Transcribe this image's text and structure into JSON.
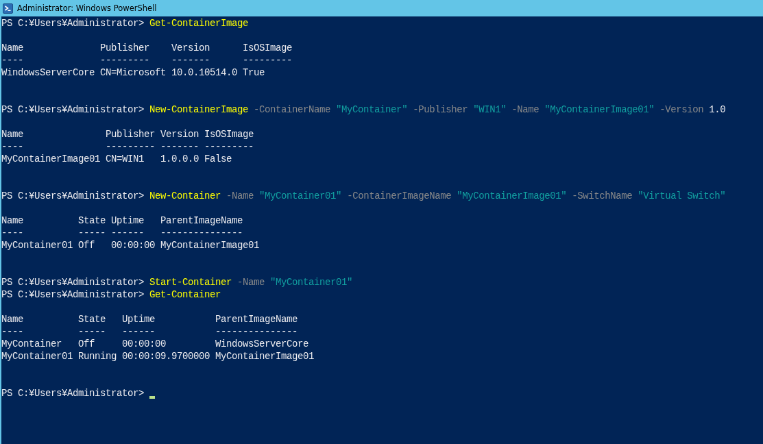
{
  "window": {
    "title": "Administrator: Windows PowerShell"
  },
  "console": {
    "entries": [
      {
        "kind": "command",
        "prompt": "PS C:¥Users¥Administrator>",
        "cursor": false,
        "tokens": [
          {
            "kind": "cmdlet",
            "text": "Get-ContainerImage"
          }
        ]
      },
      {
        "kind": "table",
        "columns": [
          {
            "header": "Name",
            "underline": "----"
          },
          {
            "header": "Publisher",
            "underline": "---------"
          },
          {
            "header": "Version",
            "underline": "-------"
          },
          {
            "header": "IsOSImage",
            "underline": "---------"
          }
        ],
        "rows": [
          [
            "WindowsServerCore",
            "CN=Microsoft",
            "10.0.10514.0",
            "True"
          ]
        ]
      },
      {
        "kind": "command",
        "prompt": "PS C:¥Users¥Administrator>",
        "cursor": false,
        "tokens": [
          {
            "kind": "cmdlet",
            "text": "New-ContainerImage"
          },
          {
            "kind": "parameter",
            "text": "-ContainerName"
          },
          {
            "kind": "string",
            "text": "\"MyContainer\""
          },
          {
            "kind": "parameter",
            "text": "-Publisher"
          },
          {
            "kind": "string",
            "text": "\"WIN1\""
          },
          {
            "kind": "parameter",
            "text": "-Name"
          },
          {
            "kind": "string",
            "text": "\"MyContainerImage01\""
          },
          {
            "kind": "parameter",
            "text": "-Version"
          },
          {
            "kind": "number",
            "text": "1.0"
          }
        ]
      },
      {
        "kind": "table",
        "columns": [
          {
            "header": "Name",
            "underline": "----"
          },
          {
            "header": "Publisher",
            "underline": "---------"
          },
          {
            "header": "Version",
            "underline": "-------"
          },
          {
            "header": "IsOSImage",
            "underline": "---------"
          }
        ],
        "rows": [
          [
            "MyContainerImage01",
            "CN=WIN1",
            "1.0.0.0",
            "False"
          ]
        ]
      },
      {
        "kind": "command",
        "prompt": "PS C:¥Users¥Administrator>",
        "cursor": false,
        "tokens": [
          {
            "kind": "cmdlet",
            "text": "New-Container"
          },
          {
            "kind": "parameter",
            "text": "-Name"
          },
          {
            "kind": "string",
            "text": "\"MyContainer01\""
          },
          {
            "kind": "parameter",
            "text": "-ContainerImageName"
          },
          {
            "kind": "string",
            "text": "\"MyContainerImage01\""
          },
          {
            "kind": "parameter",
            "text": "-SwitchName"
          },
          {
            "kind": "string",
            "text": "\"Virtual Switch\""
          }
        ]
      },
      {
        "kind": "table",
        "columns": [
          {
            "header": "Name",
            "underline": "----"
          },
          {
            "header": "State",
            "underline": "-----"
          },
          {
            "header": "Uptime",
            "underline": "------"
          },
          {
            "header": "ParentImageName",
            "underline": "---------------"
          }
        ],
        "rows": [
          [
            "MyContainer01",
            "Off",
            "00:00:00",
            "MyContainerImage01"
          ]
        ]
      },
      {
        "kind": "command",
        "prompt": "PS C:¥Users¥Administrator>",
        "cursor": false,
        "tokens": [
          {
            "kind": "cmdlet",
            "text": "Start-Container"
          },
          {
            "kind": "parameter",
            "text": "-Name"
          },
          {
            "kind": "string",
            "text": "\"MyContainer01\""
          }
        ]
      },
      {
        "kind": "command",
        "prompt": "PS C:¥Users¥Administrator>",
        "cursor": false,
        "tokens": [
          {
            "kind": "cmdlet",
            "text": "Get-Container"
          }
        ]
      },
      {
        "kind": "table",
        "columns": [
          {
            "header": "Name",
            "underline": "----"
          },
          {
            "header": "State",
            "underline": "-----"
          },
          {
            "header": "Uptime",
            "underline": "------"
          },
          {
            "header": "ParentImageName",
            "underline": "---------------"
          }
        ],
        "rows": [
          [
            "MyContainer",
            "Off",
            "00:00:00",
            "WindowsServerCore"
          ],
          [
            "MyContainer01",
            "Running",
            "00:00:09.9700000",
            "MyContainerImage01"
          ]
        ]
      },
      {
        "kind": "command",
        "prompt": "PS C:¥Users¥Administrator>",
        "cursor": true
      }
    ]
  }
}
